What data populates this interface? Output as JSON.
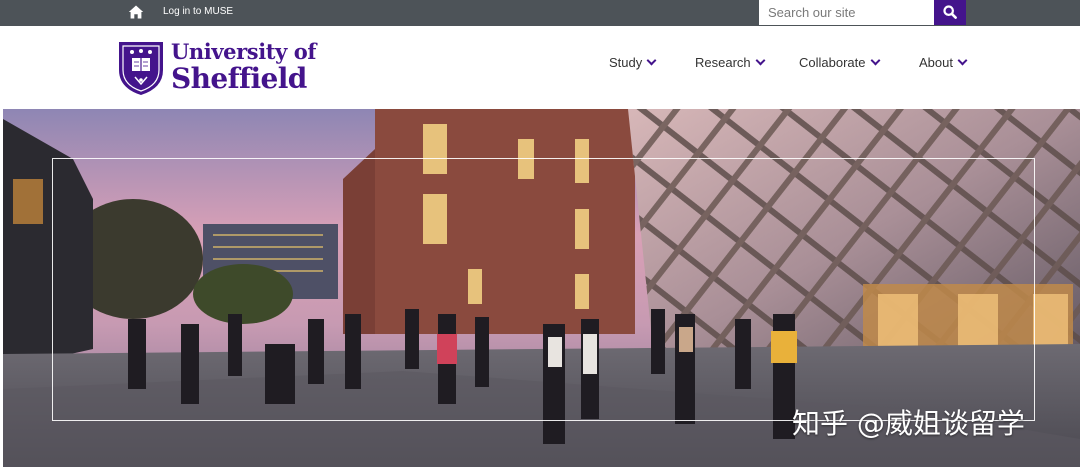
{
  "topbar": {
    "muse_label": "Log in to MUSE",
    "search_placeholder": "Search our site"
  },
  "brand": {
    "line1": "University of",
    "line2": "Sheffield",
    "color": "#44148c"
  },
  "nav": [
    {
      "label": "Study"
    },
    {
      "label": "Research"
    },
    {
      "label": "Collaborate"
    },
    {
      "label": "About"
    }
  ],
  "hero": {
    "watermark": "知乎 @威姐谈留学"
  },
  "icons": {
    "home": "home-icon",
    "search": "search-icon",
    "chevron": "chevron-down-icon",
    "crest": "university-crest"
  }
}
